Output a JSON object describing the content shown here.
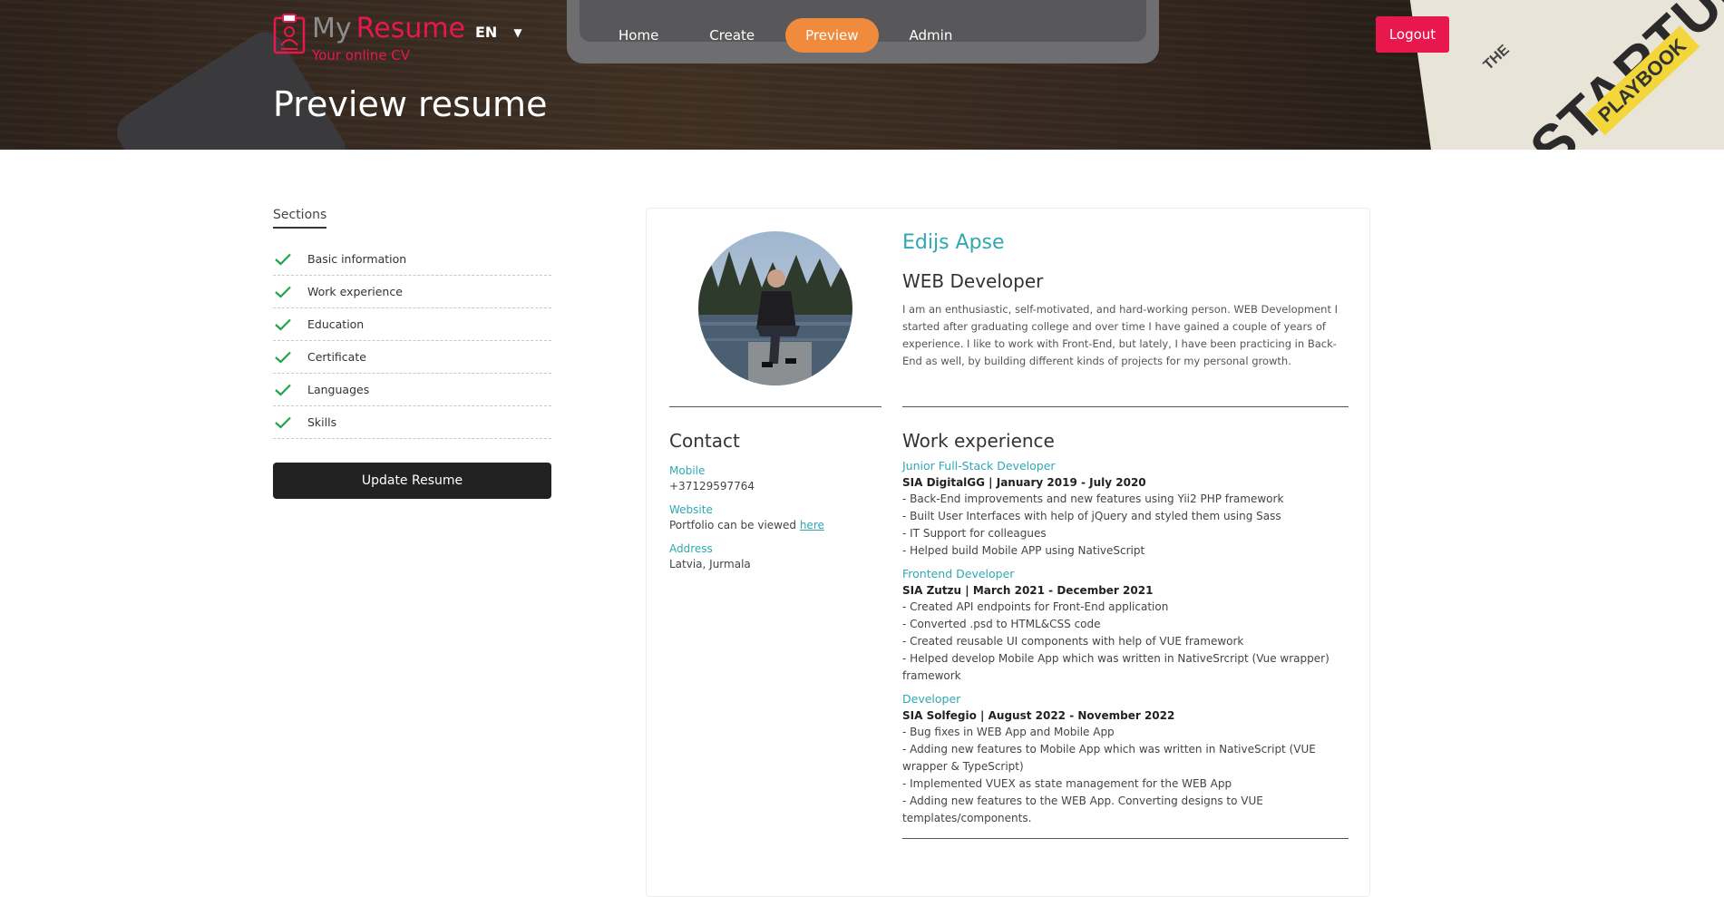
{
  "brand": {
    "my": "My",
    "resume": "Resume",
    "tagline": "Your online CV",
    "accent_color": "#e8184d"
  },
  "language": {
    "selected": "EN",
    "icon": "chevron-down-icon"
  },
  "nav": {
    "items": [
      {
        "label": "Home"
      },
      {
        "label": "Create"
      },
      {
        "label": "Preview",
        "active": true
      },
      {
        "label": "Admin"
      }
    ],
    "active_color": "#f08a3c"
  },
  "logout_label": "Logout",
  "page_title": "Preview resume",
  "hero_book": {
    "the": "THE",
    "title": "STARTUP",
    "subtitle": "PLAYBOOK"
  },
  "sidebar": {
    "title": "Sections",
    "check_color": "#22a24b",
    "items": [
      {
        "label": "Basic information",
        "done": true
      },
      {
        "label": "Work experience",
        "done": true
      },
      {
        "label": "Education",
        "done": true
      },
      {
        "label": "Certificate",
        "done": true
      },
      {
        "label": "Languages",
        "done": true
      },
      {
        "label": "Skills",
        "done": true
      }
    ],
    "update_label": "Update Resume"
  },
  "resume": {
    "name": "Edijs Apse",
    "headline": "WEB Developer",
    "about": "I am an enthusiastic, self-motivated, and hard-working person. WEB Development I started after graduating college and over time I have gained a couple of years of experience. I like to work with Front-End, but lately, I have been practicing in Back-End as well, by building different kinds of projects for my personal growth.",
    "accent_color": "#2fa8b3",
    "contact": {
      "title": "Contact",
      "mobile_label": "Mobile",
      "mobile": "+37129597764",
      "website_label": "Website",
      "website_text": "Portfolio can be viewed",
      "website_link": "here",
      "address_label": "Address",
      "address": "Latvia, Jurmala"
    },
    "work": {
      "title": "Work experience",
      "jobs": [
        {
          "title": "Junior Full-Stack Developer",
          "meta": "SIA DigitalGG | January 2019 - July 2020",
          "points": [
            "- Back-End improvements and new features using Yii2 PHP framework",
            "- Built User Interfaces with help of jQuery and styled them using Sass",
            "- IT Support for colleagues",
            "- Helped build Mobile APP using NativeScript"
          ]
        },
        {
          "title": "Frontend Developer",
          "meta": "SIA Zutzu | March 2021 - December 2021",
          "points": [
            "- Created API endpoints for Front-End application",
            "- Converted .psd to HTML&CSS code",
            "- Created reusable UI components with help of VUE framework",
            "- Helped develop Mobile App which was written in NativeSrcript (Vue wrapper) framework"
          ]
        },
        {
          "title": "Developer",
          "meta": "SIA Solfegio | August 2022 - November 2022",
          "points": [
            "- Bug fixes in WEB App and Mobile App",
            "- Adding new features to Mobile App which was written in NativeScript (VUE wrapper & TypeScript)",
            "- Implemented VUEX as state management for the WEB App",
            "- Adding new features to the WEB App. Converting designs to VUE templates/components."
          ]
        }
      ]
    }
  }
}
